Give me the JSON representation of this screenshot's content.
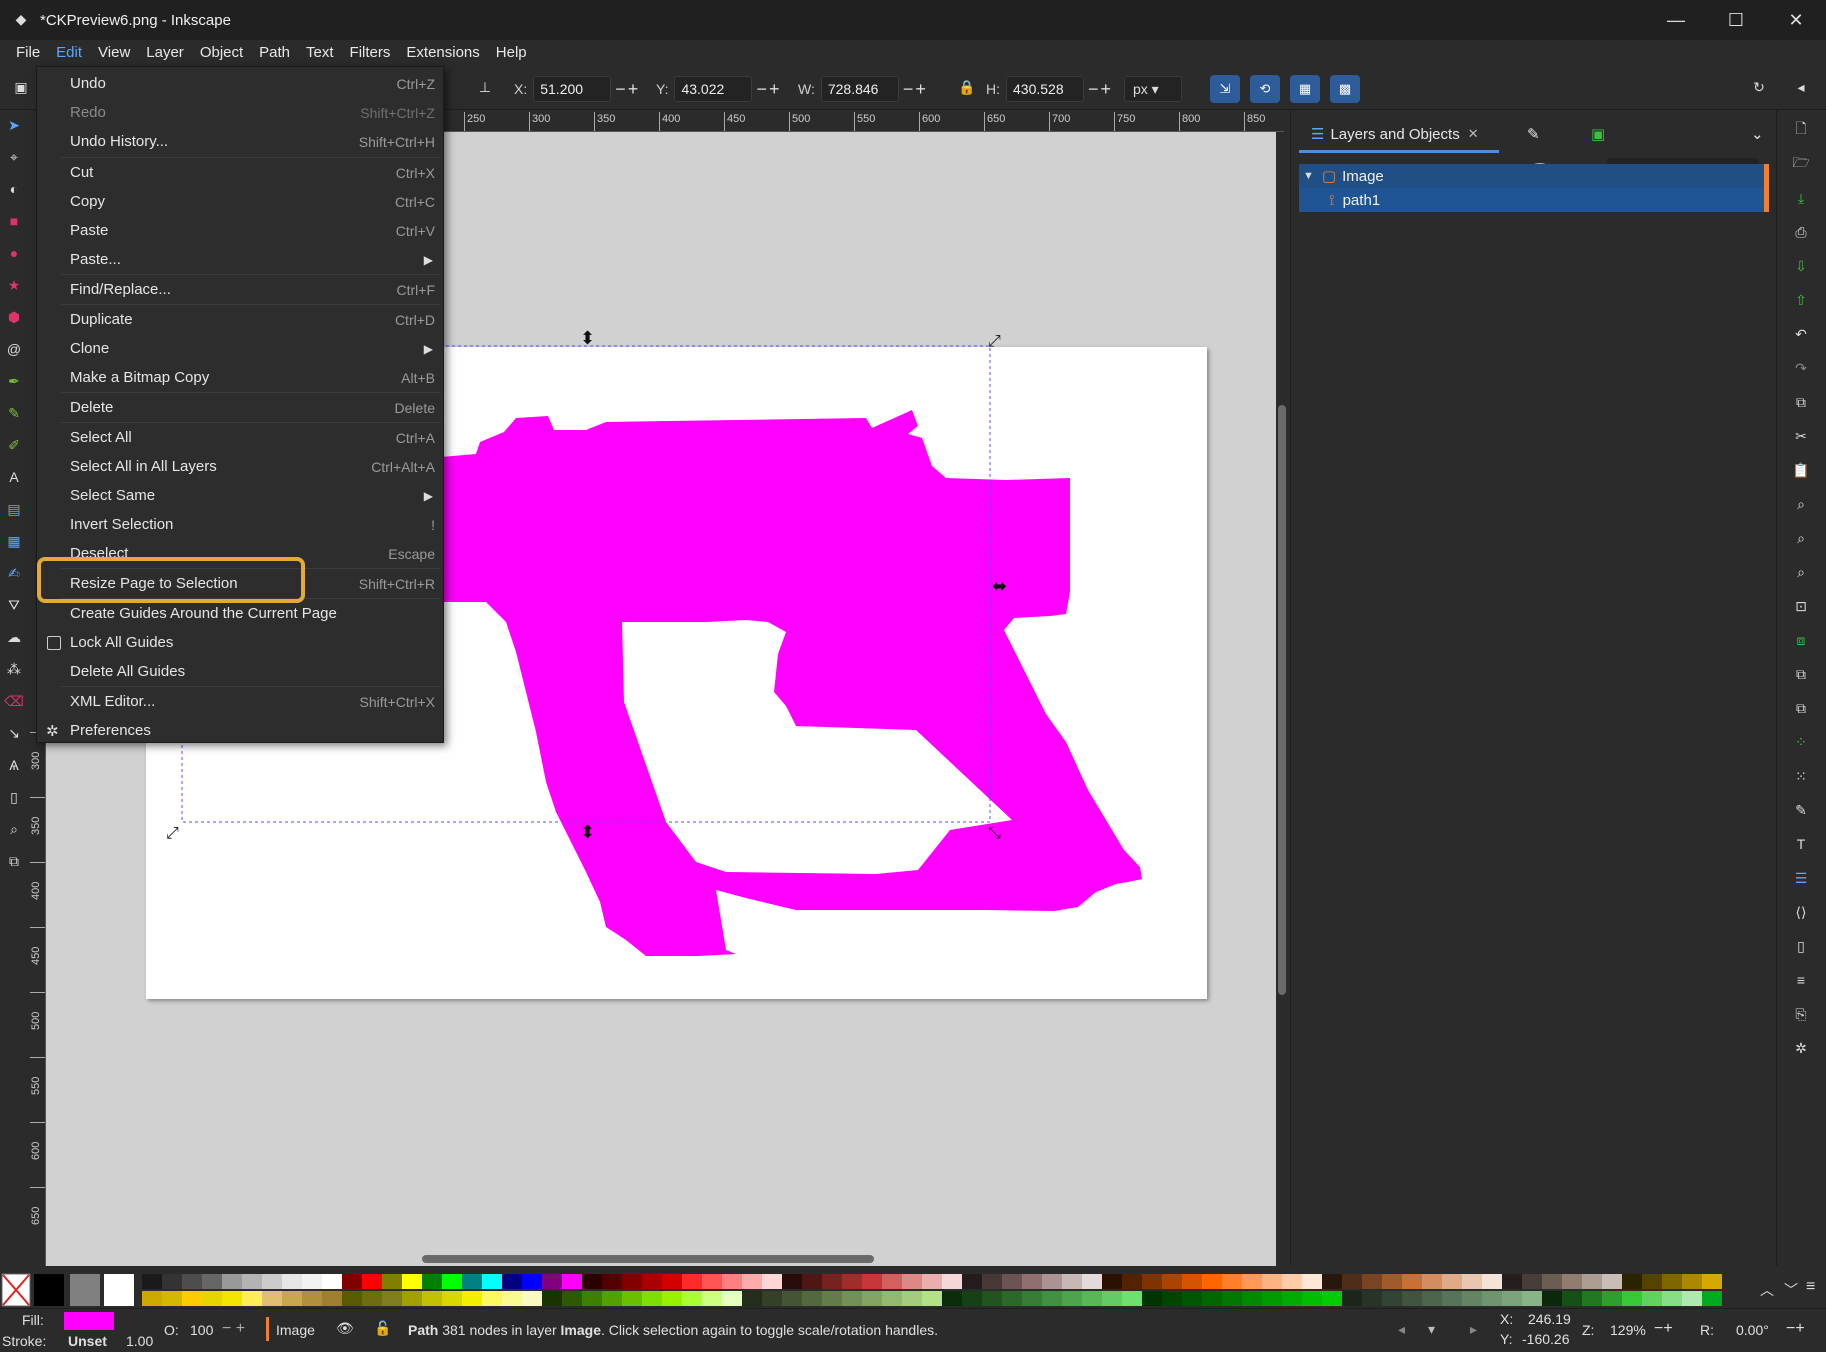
{
  "window": {
    "title": "*CKPreview6.png - Inkscape",
    "minimize": "—",
    "maximize": "☐",
    "close": "✕"
  },
  "menubar": [
    "File",
    "Edit",
    "View",
    "Layer",
    "Object",
    "Path",
    "Text",
    "Filters",
    "Extensions",
    "Help"
  ],
  "toolbar": {
    "x_label": "X:",
    "x_value": "51.200",
    "y_label": "Y:",
    "y_value": "43.022",
    "w_label": "W:",
    "w_value": "728.846",
    "h_label": "H:",
    "h_value": "430.528",
    "unit": "px"
  },
  "edit_menu": [
    {
      "label": "Undo",
      "shortcut": "Ctrl+Z"
    },
    {
      "label": "Redo",
      "shortcut": "Shift+Ctrl+Z",
      "disabled": true
    },
    {
      "label": "Undo History...",
      "shortcut": "Shift+Ctrl+H"
    },
    {
      "label": "Cut",
      "shortcut": "Ctrl+X"
    },
    {
      "label": "Copy",
      "shortcut": "Ctrl+C"
    },
    {
      "label": "Paste",
      "shortcut": "Ctrl+V"
    },
    {
      "label": "Paste...",
      "shortcut": "",
      "submenu": true
    },
    {
      "label": "Find/Replace...",
      "shortcut": "Ctrl+F"
    },
    {
      "label": "Duplicate",
      "shortcut": "Ctrl+D"
    },
    {
      "label": "Clone",
      "shortcut": "",
      "submenu": true
    },
    {
      "label": "Make a Bitmap Copy",
      "shortcut": "Alt+B"
    },
    {
      "label": "Delete",
      "shortcut": "Delete"
    },
    {
      "label": "Select All",
      "shortcut": "Ctrl+A"
    },
    {
      "label": "Select All in All Layers",
      "shortcut": "Ctrl+Alt+A"
    },
    {
      "label": "Select Same",
      "shortcut": "",
      "submenu": true
    },
    {
      "label": "Invert Selection",
      "shortcut": "!"
    },
    {
      "label": "Deselect",
      "shortcut": "Escape"
    },
    {
      "label": "Resize Page to Selection",
      "shortcut": "Shift+Ctrl+R"
    },
    {
      "label": "Create Guides Around the Current Page",
      "shortcut": ""
    },
    {
      "label": "Lock All Guides",
      "shortcut": "",
      "checkbox": true
    },
    {
      "label": "Delete All Guides",
      "shortcut": ""
    },
    {
      "label": "XML Editor...",
      "shortcut": "Shift+Ctrl+X"
    },
    {
      "label": "Preferences",
      "shortcut": ""
    }
  ],
  "ruler_top": [
    "250",
    "300",
    "350",
    "400",
    "450",
    "500",
    "550",
    "600",
    "650",
    "700",
    "750",
    "800",
    "850"
  ],
  "ruler_left": [
    "300",
    "350",
    "400",
    "450",
    "500",
    "550",
    "600",
    "650"
  ],
  "dock": {
    "tab_label": "Layers and Objects",
    "tree": [
      {
        "label": "Image",
        "type": "layer"
      },
      {
        "label": "path1",
        "type": "path"
      }
    ]
  },
  "colors": {
    "fill": "#ff00ff",
    "highlight": "#e5a93a",
    "selection": "#1f5594"
  },
  "status": {
    "fill_label": "Fill:",
    "stroke_label": "Stroke:",
    "stroke_value": "Unset",
    "stroke_width": "1.00",
    "opacity_label": "O:",
    "opacity_value": "100",
    "layer_name": "Image",
    "message_bold1": "Path",
    "message_mid": " 381 nodes in layer ",
    "message_bold2": "Image",
    "message_end": ". Click selection again to toggle scale/rotation handles.",
    "cx_label": "X:",
    "cx_value": "246.19",
    "cy_label": "Y:",
    "cy_value": "-160.26",
    "zoom_label": "Z:",
    "zoom_value": "129%",
    "rot_label": "R:",
    "rot_value": "0.00°"
  }
}
